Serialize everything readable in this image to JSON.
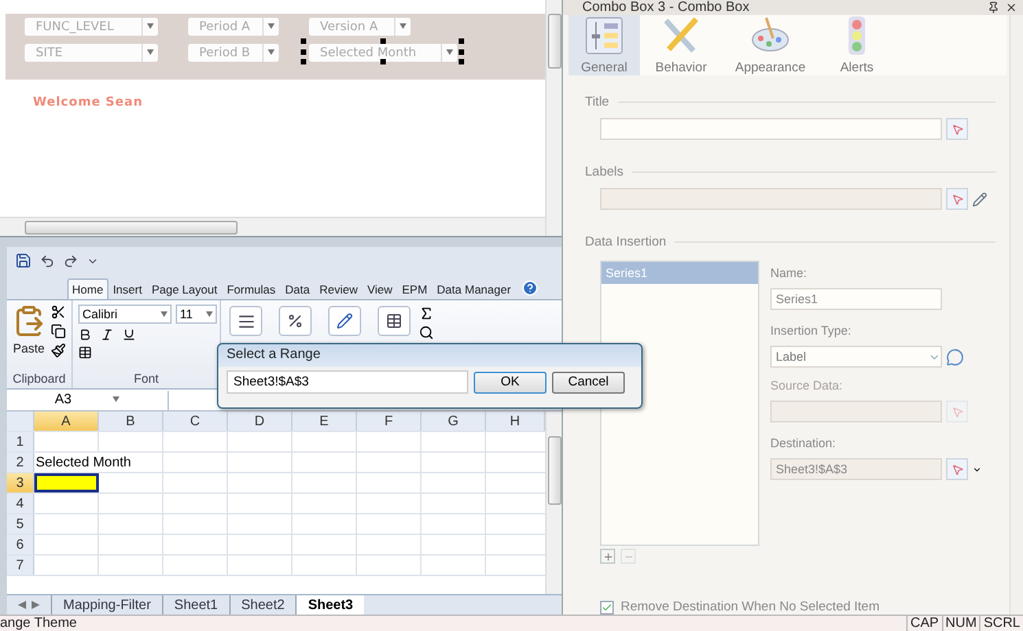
{
  "dashboard": {
    "filters": [
      {
        "label": "FUNC_LEVEL",
        "selected": false
      },
      {
        "label": "SITE",
        "selected": false
      }
    ],
    "periods": [
      {
        "label": "Period A",
        "selected": false
      },
      {
        "label": "Period B",
        "selected": false
      }
    ],
    "versions": [
      {
        "label": "Version A",
        "selected": false
      },
      {
        "label": "Selected Month",
        "selected": true
      }
    ],
    "welcome": "Welcome Sean"
  },
  "excel": {
    "ribbon_tabs": [
      {
        "label": "Home",
        "selected": true
      },
      {
        "label": "Insert",
        "selected": false
      },
      {
        "label": "Page Layout",
        "selected": false
      },
      {
        "label": "Formulas",
        "selected": false
      },
      {
        "label": "Data",
        "selected": false
      },
      {
        "label": "Review",
        "selected": false
      },
      {
        "label": "View",
        "selected": false
      },
      {
        "label": "EPM",
        "selected": false
      },
      {
        "label": "Data Manager",
        "selected": false
      }
    ],
    "paste_label": "Paste",
    "clipboard_group": "Clipboard",
    "font_group": "Font",
    "font_name": "Calibri",
    "font_size": "11",
    "name_box": "A3",
    "columns": [
      {
        "label": "A",
        "selected": true
      },
      {
        "label": "B",
        "selected": false
      },
      {
        "label": "C",
        "selected": false
      },
      {
        "label": "D",
        "selected": false
      },
      {
        "label": "E",
        "selected": false
      },
      {
        "label": "F",
        "selected": false
      },
      {
        "label": "G",
        "selected": false
      },
      {
        "label": "H",
        "selected": false
      }
    ],
    "rows": [
      {
        "number": "1",
        "selected": false
      },
      {
        "number": "2",
        "selected": false,
        "column_a": "Selected Month"
      },
      {
        "number": "3",
        "selected": true
      },
      {
        "number": "4",
        "selected": false
      },
      {
        "number": "5",
        "selected": false
      },
      {
        "number": "6",
        "selected": false
      },
      {
        "number": "7",
        "selected": false
      }
    ],
    "sheet_tabs": [
      {
        "label": "Mapping-Filter",
        "selected": false
      },
      {
        "label": "Sheet1",
        "selected": false
      },
      {
        "label": "Sheet2",
        "selected": false
      },
      {
        "label": "Sheet3",
        "selected": true
      }
    ]
  },
  "dialog": {
    "title": "Select a Range",
    "value": "Sheet3!$A$3",
    "buttons": [
      "OK",
      "Cancel"
    ]
  },
  "properties": {
    "title": "Combo Box 3 - Combo Box",
    "tabs": [
      {
        "label": "General",
        "selected": true,
        "kind": "sliders"
      },
      {
        "label": "Behavior",
        "selected": false,
        "kind": "tools"
      },
      {
        "label": "Appearance",
        "selected": false,
        "kind": "palette"
      },
      {
        "label": "Alerts",
        "selected": false,
        "kind": "lights"
      }
    ],
    "title_section": "Title",
    "labels_section": "Labels",
    "labels_disabled": true,
    "data_section": "Data Insertion",
    "series": [
      {
        "label": "Series1",
        "selected": true
      }
    ],
    "name_label": "Name:",
    "name_value": "Series1",
    "insertion_label": "Insertion Type:",
    "insertion_value": "Label",
    "source_label": "Source Data:",
    "source_disabled": true,
    "destination_label": "Destination:",
    "destination_value": "Sheet3!$A$3",
    "remove_checkbox": {
      "label": "Remove Destination When No Selected Item",
      "checked": true
    }
  },
  "status_bar": {
    "text": "ange Theme",
    "indicators": [
      "CAP",
      "NUM",
      "SCRL"
    ]
  }
}
